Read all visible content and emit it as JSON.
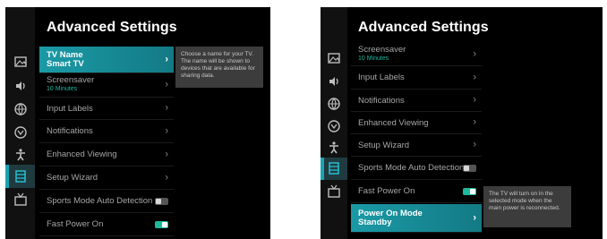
{
  "left_screen": {
    "title": "Advanced Settings",
    "rail_icons": [
      "picture-icon",
      "sound-icon",
      "network-icon",
      "system-icon",
      "accessibility-icon",
      "advanced-settings-icon",
      "tv-icon"
    ],
    "items": [
      {
        "label": "TV Name",
        "value": "Smart TV",
        "selected": true
      },
      {
        "label": "Screensaver",
        "value": "10 Minutes"
      },
      {
        "label": "Input Labels"
      },
      {
        "label": "Notifications"
      },
      {
        "label": "Enhanced Viewing"
      },
      {
        "label": "Setup Wizard"
      },
      {
        "label": "Sports Mode Auto Detection",
        "toggle": "off"
      },
      {
        "label": "Fast Power On",
        "toggle": "on"
      }
    ],
    "tooltip": "Choose a name for your TV. The name will be shown to devices that are available for sharing data."
  },
  "right_screen": {
    "title": "Advanced Settings",
    "rail_icons": [
      "picture-icon",
      "sound-icon",
      "network-icon",
      "system-icon",
      "accessibility-icon",
      "advanced-settings-icon",
      "tv-icon"
    ],
    "items": [
      {
        "label": "Screensaver",
        "value": "10 Minutes"
      },
      {
        "label": "Input Labels"
      },
      {
        "label": "Notifications"
      },
      {
        "label": "Enhanced Viewing"
      },
      {
        "label": "Setup Wizard"
      },
      {
        "label": "Sports Mode Auto Detection",
        "toggle": "off"
      },
      {
        "label": "Fast Power On",
        "toggle": "on"
      },
      {
        "label": "Power On Mode",
        "value": "Standby",
        "selected": true
      }
    ],
    "tooltip": "The TV will turn on in the selected mode when the main power is reconnected."
  },
  "colors": {
    "accent": "#1a9aa6",
    "value_green": "#19b79f",
    "toggle_on": "#1fb89a"
  }
}
